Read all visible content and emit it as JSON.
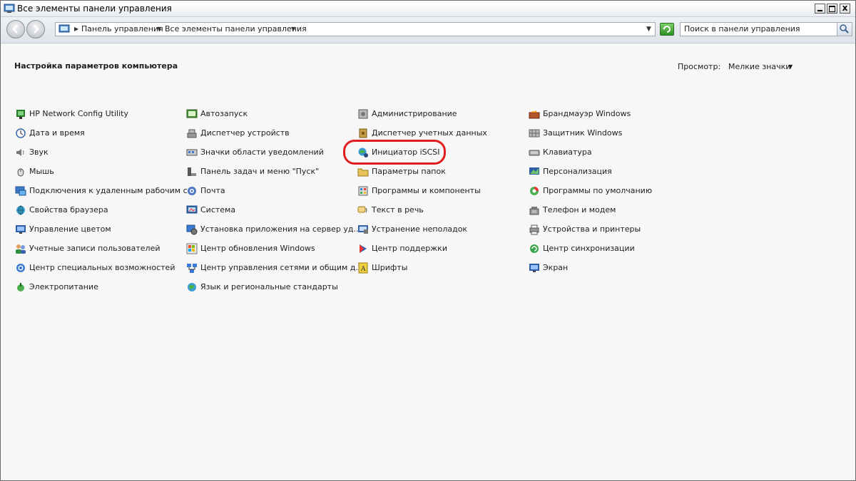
{
  "window": {
    "title": "Все элементы панели управления",
    "close_glyph": "x"
  },
  "address_bar": {
    "breadcrumbs": [
      "Панель управления",
      "Все элементы панели управления"
    ]
  },
  "search": {
    "placeholder": "Поиск в панели управления"
  },
  "content": {
    "title": "Настройка параметров компьютера",
    "view_label": "Просмотр:",
    "view_value": "Мелкие значки"
  },
  "columns": [
    [
      {
        "label": "HP Network Config Utility",
        "icon": "network-utility-icon"
      },
      {
        "label": "Дата и время",
        "icon": "clock-icon"
      },
      {
        "label": "Звук",
        "icon": "speaker-icon"
      },
      {
        "label": "Мышь",
        "icon": "mouse-icon"
      },
      {
        "label": "Подключения к удаленным рабочим с...",
        "icon": "remote-desktop-icon"
      },
      {
        "label": "Свойства браузера",
        "icon": "internet-options-icon"
      },
      {
        "label": "Управление цветом",
        "icon": "color-management-icon"
      },
      {
        "label": "Учетные записи пользователей",
        "icon": "users-icon"
      },
      {
        "label": "Центр специальных возможностей",
        "icon": "accessibility-icon"
      },
      {
        "label": "Электропитание",
        "icon": "power-icon"
      }
    ],
    [
      {
        "label": "Автозапуск",
        "icon": "autoplay-icon"
      },
      {
        "label": "Диспетчер устройств",
        "icon": "device-manager-icon"
      },
      {
        "label": "Значки области уведомлений",
        "icon": "notification-icons-icon"
      },
      {
        "label": "Панель задач и меню \"Пуск\"",
        "icon": "taskbar-icon"
      },
      {
        "label": "Почта",
        "icon": "mail-icon"
      },
      {
        "label": "Система",
        "icon": "system-icon"
      },
      {
        "label": "Установка приложения на сервер уд...",
        "icon": "install-app-icon"
      },
      {
        "label": "Центр обновления Windows",
        "icon": "windows-update-icon"
      },
      {
        "label": "Центр управления сетями и общим д...",
        "icon": "network-center-icon"
      },
      {
        "label": "Язык и региональные стандарты",
        "icon": "region-icon"
      }
    ],
    [
      {
        "label": "Администрирование",
        "icon": "admin-tools-icon"
      },
      {
        "label": "Диспетчер учетных данных",
        "icon": "credential-manager-icon"
      },
      {
        "label": "Инициатор iSCSI",
        "icon": "iscsi-icon"
      },
      {
        "label": "Параметры папок",
        "icon": "folder-options-icon"
      },
      {
        "label": "Программы и компоненты",
        "icon": "programs-icon"
      },
      {
        "label": "Текст в речь",
        "icon": "text-to-speech-icon"
      },
      {
        "label": "Устранение неполадок",
        "icon": "troubleshooting-icon"
      },
      {
        "label": "Центр поддержки",
        "icon": "action-center-icon"
      },
      {
        "label": "Шрифты",
        "icon": "fonts-icon"
      }
    ],
    [
      {
        "label": "Брандмауэр Windows",
        "icon": "firewall-icon"
      },
      {
        "label": "Защитник Windows",
        "icon": "defender-icon"
      },
      {
        "label": "Клавиатура",
        "icon": "keyboard-icon"
      },
      {
        "label": "Персонализация",
        "icon": "personalization-icon"
      },
      {
        "label": "Программы по умолчанию",
        "icon": "default-programs-icon"
      },
      {
        "label": "Телефон и модем",
        "icon": "phone-modem-icon"
      },
      {
        "label": "Устройства и принтеры",
        "icon": "devices-printers-icon"
      },
      {
        "label": "Центр синхронизации",
        "icon": "sync-center-icon"
      },
      {
        "label": "Экран",
        "icon": "display-icon"
      }
    ]
  ],
  "highlighted_item": "Инициатор iSCSI",
  "colors": {
    "highlight": "#e11d1d",
    "background": "#f7f7f7",
    "text": "#1e1e1e"
  }
}
